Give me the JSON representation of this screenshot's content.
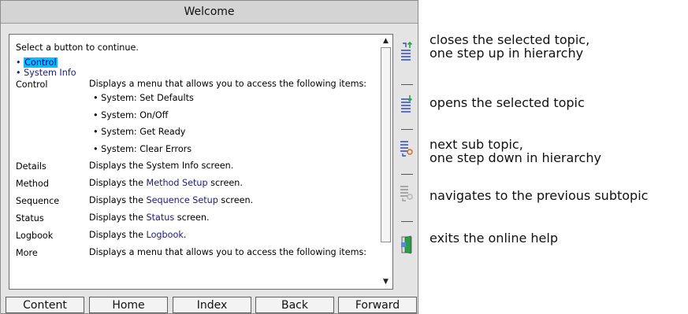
{
  "window": {
    "title": "Welcome"
  },
  "help": {
    "intro": "Select a button to continue.",
    "toc": [
      "Control",
      "System Info"
    ],
    "control": {
      "term": "Control",
      "desc": "Displays a menu that allows you to access the following items:",
      "items": [
        "System: Set Defaults",
        "System: On/Off",
        "System: Get Ready",
        "System: Clear Errors"
      ]
    },
    "details": {
      "term": "Details",
      "desc": "Displays the System Info screen."
    },
    "method": {
      "term": "Method",
      "pre": "Displays the ",
      "link": "Method Setup",
      "post": " screen."
    },
    "sequence": {
      "term": "Sequence",
      "pre": "Displays the ",
      "link": "Sequence Setup",
      "post": " screen."
    },
    "status": {
      "term": "Status",
      "pre": "Displays the ",
      "link": "Status",
      "post": " screen."
    },
    "logbook": {
      "term": "Logbook",
      "pre": "Displays the ",
      "link": "Logbook",
      "post": "."
    },
    "more": {
      "term": "More",
      "desc": "Displays a menu that allows you to access the following items:"
    }
  },
  "nav": {
    "content": "Content",
    "home": "Home",
    "index": "Index",
    "back": "Back",
    "forward": "Forward"
  },
  "callouts": {
    "close_line1": "closes the selected topic,",
    "close_line2": "one step up in hierarchy",
    "open": "opens the selected topic",
    "next_line1": "next sub topic,",
    "next_line2": "one step down in hierarchy",
    "prev": "navigates to the previous subtopic",
    "exit": "exits the online help"
  },
  "colors": {
    "link": "#1a1a8c",
    "selection": "#00c0ff",
    "door": "#2aa04a"
  }
}
